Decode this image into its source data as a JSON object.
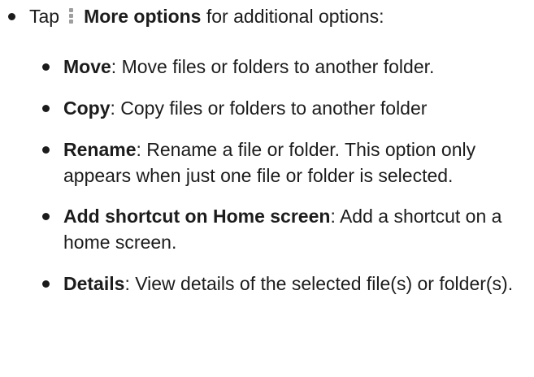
{
  "main": {
    "prefix": "Tap",
    "icon": "more-options-icon",
    "bold": "More options",
    "suffix": " for additional options:"
  },
  "items": [
    {
      "term": "Move",
      "desc": ": Move files or folders to another folder."
    },
    {
      "term": "Copy",
      "desc": ": Copy files or folders to another folder"
    },
    {
      "term": "Rename",
      "desc": ": Rename a file or folder. This option only appears when just one file or folder is selected."
    },
    {
      "term": "Add shortcut on Home screen",
      "desc": ": Add a shortcut on a home screen."
    },
    {
      "term": "Details",
      "desc": ": View details of the selected file(s) or folder(s)."
    }
  ]
}
